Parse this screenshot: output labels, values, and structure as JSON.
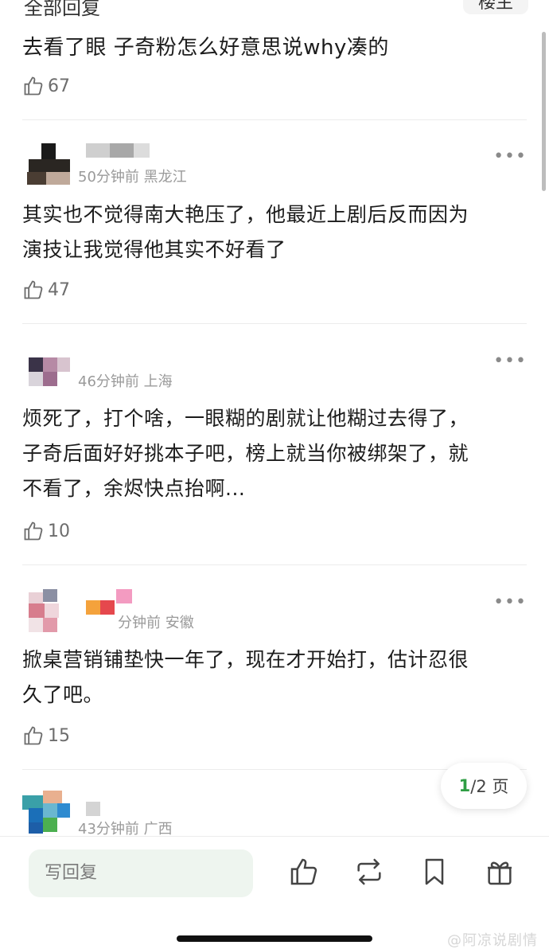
{
  "top": {
    "partial_label": "全部回复",
    "button_label": "楼主"
  },
  "first_comment": {
    "text": "去看了眼 子奇粉怎么好意思说why凑的",
    "likes": "67"
  },
  "comments": [
    {
      "meta": "50分钟前 黑龙江",
      "text": [
        "其实也不觉得南大艳压了，他最近上剧后反而因为",
        "演技让我觉得他其实不好看了"
      ],
      "likes": "47",
      "more": "•••"
    },
    {
      "meta": "46分钟前 上海",
      "text": [
        "烦死了，打个啥，一眼糊的剧就让他糊过去得了，",
        "子奇后面好好挑本子吧，榜上就当你被绑架了，就",
        "不看了，余烬快点抬啊..."
      ],
      "likes": "10",
      "more": "•••"
    },
    {
      "meta": "分钟前 安徽",
      "text": [
        "掀桌营销铺垫快一年了，现在才开始打，估计忍很",
        "久了吧。"
      ],
      "likes": "15",
      "more": "•••"
    },
    {
      "meta": "43分钟前 广西"
    }
  ],
  "pagination": {
    "current": "1",
    "rest": "/2 页"
  },
  "bottom_bar": {
    "reply_placeholder": "写回复",
    "icons": [
      "thumb-up-icon",
      "repost-icon",
      "bookmark-icon",
      "gift-icon"
    ]
  },
  "watermark": "@阿凉说剧情",
  "colors": {
    "accent": "#2f9e44",
    "reply_bg": "#eef5ef",
    "meta_gray": "#9a9a9a"
  }
}
